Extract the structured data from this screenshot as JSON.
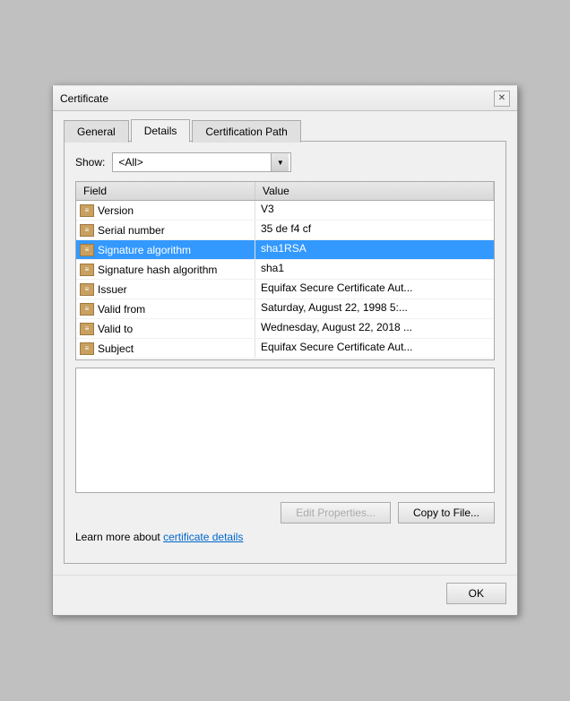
{
  "dialog": {
    "title": "Certificate",
    "close_label": "✕"
  },
  "tabs": [
    {
      "id": "general",
      "label": "General",
      "active": false
    },
    {
      "id": "details",
      "label": "Details",
      "active": true
    },
    {
      "id": "certification-path",
      "label": "Certification Path",
      "active": false
    }
  ],
  "show": {
    "label": "Show:",
    "value": "<All>",
    "arrow": "▼"
  },
  "table": {
    "headers": [
      {
        "id": "field",
        "label": "Field"
      },
      {
        "id": "value",
        "label": "Value"
      }
    ],
    "rows": [
      {
        "field": "Version",
        "value": "V3"
      },
      {
        "field": "Serial number",
        "value": "35 de f4 cf"
      },
      {
        "field": "Signature algorithm",
        "value": "sha1RSA"
      },
      {
        "field": "Signature hash algorithm",
        "value": "sha1"
      },
      {
        "field": "Issuer",
        "value": "Equifax Secure Certificate Aut..."
      },
      {
        "field": "Valid from",
        "value": "Saturday, August 22, 1998 5:..."
      },
      {
        "field": "Valid to",
        "value": "Wednesday, August 22, 2018 ..."
      },
      {
        "field": "Subject",
        "value": "Equifax Secure Certificate Aut..."
      }
    ]
  },
  "buttons": {
    "edit_properties": "Edit Properties...",
    "copy_to_file": "Copy to File..."
  },
  "learn_more": {
    "prefix": "Learn more about ",
    "link_text": "certificate details"
  },
  "footer": {
    "ok_label": "OK"
  }
}
